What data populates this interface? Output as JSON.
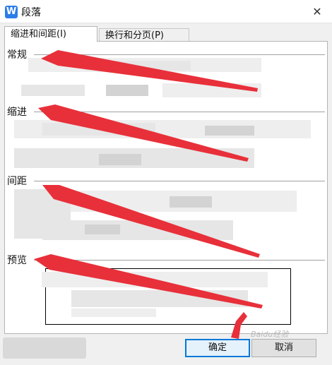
{
  "window": {
    "title": "段落",
    "app_icon_letter": "W",
    "close_glyph": "✕"
  },
  "tabs": [
    {
      "label": "缩进和间距(I)",
      "active": true
    },
    {
      "label": "换行和分页(P)",
      "active": false
    }
  ],
  "sections": {
    "general": "常规",
    "indent": "缩进",
    "spacing": "间距",
    "preview": "预览"
  },
  "buttons": {
    "ok": "确定",
    "cancel": "取消"
  },
  "watermark": "Baidu经验",
  "colors": {
    "accent": "#0078d7",
    "annotation_arrow": "#e8303a"
  }
}
